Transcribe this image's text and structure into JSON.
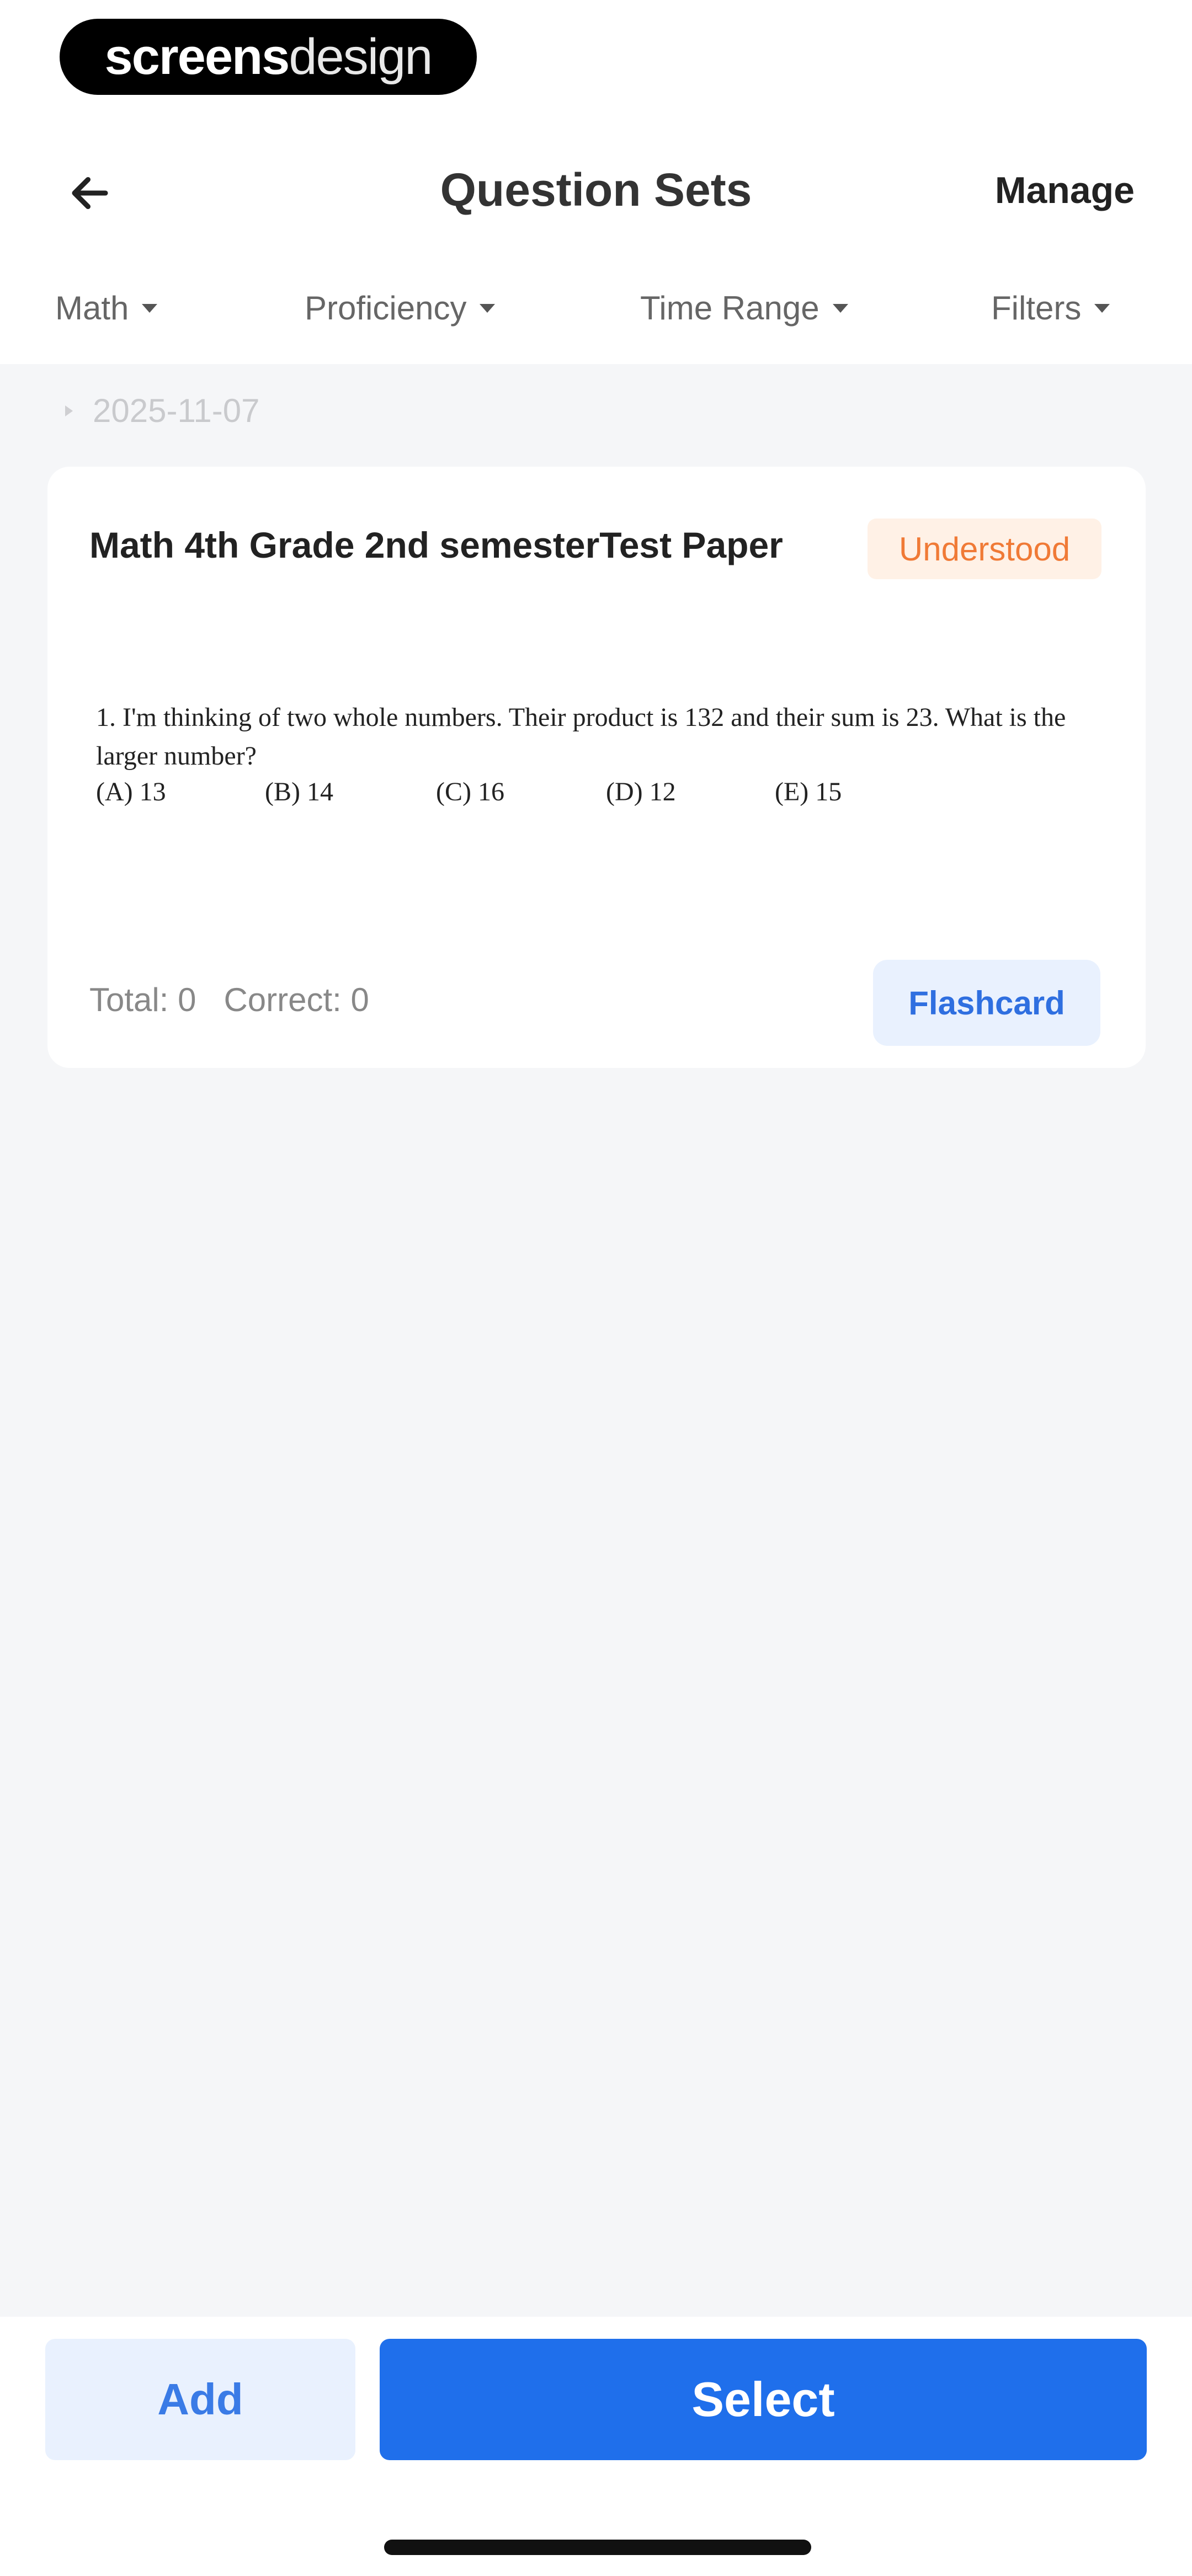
{
  "brand": {
    "logo_bold": "screens",
    "logo_light": "design"
  },
  "header": {
    "title": "Question Sets",
    "manage_label": "Manage"
  },
  "filters": [
    {
      "label": "Math"
    },
    {
      "label": "Proficiency"
    },
    {
      "label": "Time Range"
    },
    {
      "label": "Filters"
    }
  ],
  "date_group": {
    "label": "2025-11-07"
  },
  "card": {
    "title": "Math 4th Grade 2nd semesterTest Paper",
    "status_tag": "Understood",
    "question": "1. I'm thinking of two whole numbers. Their product is 132 and their sum is 23. What is the larger number?",
    "options": [
      "(A) 13",
      "(B) 14",
      "(C) 16",
      "(D) 12",
      "(E) 15"
    ],
    "total_label": "Total: 0",
    "correct_label": "Correct: 0",
    "flashcard_label": "Flashcard"
  },
  "footer": {
    "add_label": "Add",
    "select_label": "Select"
  },
  "colors": {
    "accent": "#1F6FEB",
    "accent_light": "#E9F1FE",
    "tag_text": "#F07A36",
    "tag_bg": "#FFF1E6",
    "page_bg": "#F5F6F8"
  }
}
